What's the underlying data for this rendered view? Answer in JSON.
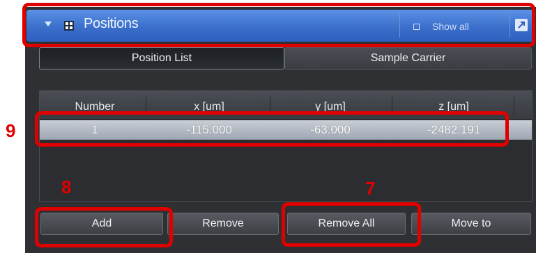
{
  "header": {
    "title": "Positions",
    "show_all_label": "Show all",
    "icon": "positions-icon",
    "link_icon": "detach-icon"
  },
  "tabs": [
    {
      "label": "Position List",
      "active": true
    },
    {
      "label": "Sample Carrier",
      "active": false
    }
  ],
  "table": {
    "columns": [
      "Number",
      "x [um]",
      "y [um]",
      "z [um]"
    ],
    "rows": [
      {
        "number": "1",
        "x": "-115.000",
        "y": "-63.000",
        "z": "-2482.191"
      }
    ]
  },
  "buttons": {
    "add": "Add",
    "remove": "Remove",
    "remove_all": "Remove All",
    "move_to": "Move to"
  },
  "annotations": {
    "label_9": "9",
    "label_8": "8",
    "label_7": "7",
    "color": "#e00000"
  }
}
